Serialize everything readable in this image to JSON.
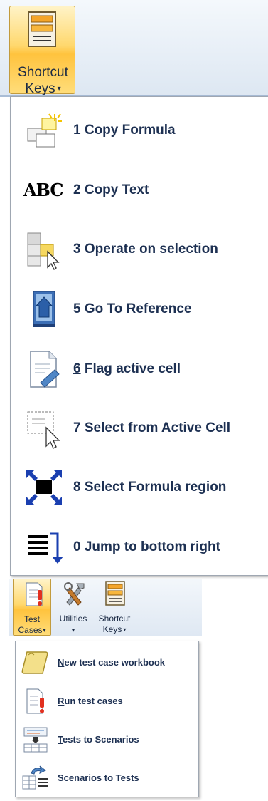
{
  "ribbon_top": {
    "shortcut_keys_line1": "Shortcut",
    "shortcut_keys_line2": "Keys",
    "caret": "▾"
  },
  "shortcut_menu": {
    "items": [
      {
        "accel": "1",
        "label": " Copy Formula",
        "icon": "copy-formula-icon"
      },
      {
        "accel": "2",
        "label": " Copy Text",
        "icon": "copy-text-icon"
      },
      {
        "accel": "3",
        "label": " Operate on selection",
        "icon": "operate-selection-icon"
      },
      {
        "accel": "5",
        "label": " Go To Reference",
        "icon": "go-to-reference-icon"
      },
      {
        "accel": "6",
        "label": " Flag active cell",
        "icon": "flag-cell-icon"
      },
      {
        "accel": "7",
        "label": " Select from Active Cell",
        "icon": "select-from-cell-icon"
      },
      {
        "accel": "8",
        "label": " Select Formula region",
        "icon": "select-region-icon"
      },
      {
        "accel": "0",
        "label": " Jump to bottom right",
        "icon": "jump-bottom-right-icon"
      }
    ],
    "abc_glyph": "ABC"
  },
  "ribbon_bottom": {
    "test_cases_line1": "Test",
    "test_cases_line2": "Cases",
    "utilities_line1": "Utilities",
    "utilities_line2": "▾",
    "shortcut_line1": "Shortcut",
    "shortcut_line2": "Keys",
    "caret": "▾"
  },
  "test_menu": {
    "items": [
      {
        "accel": "N",
        "label": "ew test case workbook",
        "icon": "new-workbook-icon"
      },
      {
        "accel": "R",
        "label": "un test cases",
        "icon": "run-tests-icon"
      },
      {
        "accel": "T",
        "label": "ests to Scenarios",
        "icon": "tests-to-scenarios-icon"
      },
      {
        "accel": "S",
        "label": "cenarios to Tests",
        "icon": "scenarios-to-tests-icon"
      }
    ]
  },
  "colors": {
    "accent_orange": "#ffc33e",
    "ribbon_blue": "#dde7f2",
    "menu_text": "#1d3052"
  }
}
